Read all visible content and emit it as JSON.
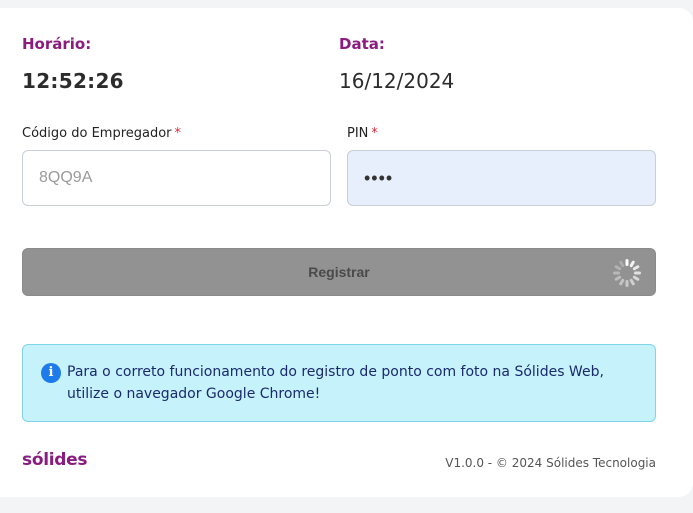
{
  "time": {
    "label": "Horário:",
    "value": "12:52:26"
  },
  "date": {
    "label": "Data:",
    "value": "16/12/2024"
  },
  "employer": {
    "label": "Código do Empregador",
    "required_mark": "*",
    "placeholder": "8QQ9A"
  },
  "pin": {
    "label": "PIN",
    "required_mark": "*",
    "value": "••••"
  },
  "submit": {
    "label": "Registrar"
  },
  "alert": {
    "icon": "info-icon",
    "text": "Para o correto funcionamento do registro de ponto com foto na Sólides Web, utilize o navegador Google Chrome!"
  },
  "footer": {
    "logo_text": "sólides",
    "version": "V1.0.0 - © 2024 Sólides Tecnologia"
  },
  "colors": {
    "brand": "#8a1c80",
    "required": "#d62839",
    "alert_bg": "#c6f2fb",
    "info_blue": "#1e7bea",
    "button_disabled": "#929292"
  }
}
